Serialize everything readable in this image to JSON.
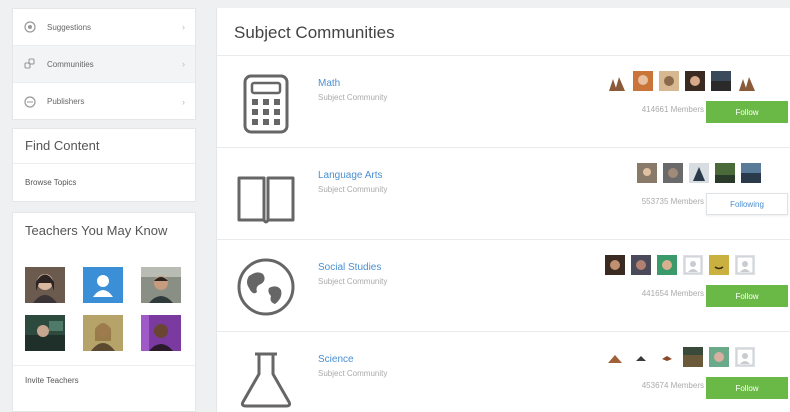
{
  "sidebar": {
    "nav": [
      {
        "label": "Suggestions",
        "icon": "suggestions-icon"
      },
      {
        "label": "Communities",
        "icon": "communities-icon"
      },
      {
        "label": "Publishers",
        "icon": "publishers-icon"
      }
    ],
    "find_content": {
      "title": "Find Content",
      "link": "Browse Topics"
    },
    "teachers": {
      "title": "Teachers You May Know",
      "avatars": [
        "teacher-photo",
        "default-avatar",
        "teacher-photo",
        "teacher-photo",
        "teacher-photo",
        "teacher-photo"
      ],
      "invite": "Invite Teachers"
    }
  },
  "main": {
    "title": "Subject Communities",
    "communities": [
      {
        "name": "Math",
        "type": "Subject Community",
        "members": "414661 Members",
        "button": "Follow",
        "following": false,
        "icon": "calculator-icon"
      },
      {
        "name": "Language Arts",
        "type": "Subject Community",
        "members": "553735 Members",
        "button": "Following",
        "following": true,
        "icon": "book-icon"
      },
      {
        "name": "Social Studies",
        "type": "Subject Community",
        "members": "441654 Members",
        "button": "Follow",
        "following": false,
        "icon": "globe-icon"
      },
      {
        "name": "Science",
        "type": "Subject Community",
        "members": "453674 Members",
        "button": "Follow",
        "following": false,
        "icon": "flask-icon"
      }
    ]
  },
  "colors": {
    "accent_green": "#6ab947",
    "link_blue": "#4a8fd0",
    "avatar_blue": "#3a8fd6"
  }
}
